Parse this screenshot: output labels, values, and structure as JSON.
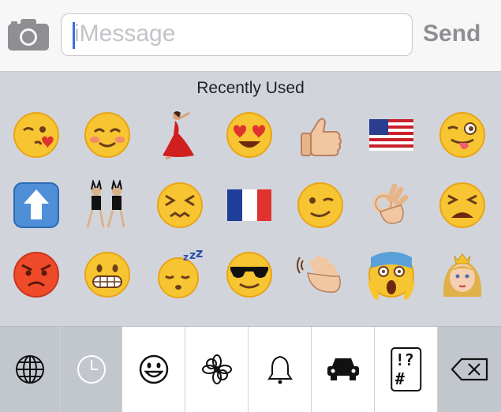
{
  "compose": {
    "placeholder": "iMessage",
    "send_label": "Send"
  },
  "emoji_panel": {
    "section_title": "Recently Used",
    "rows": [
      [
        "kissing-face-heart",
        "blushing-face",
        "dancer",
        "heart-eyes-face",
        "thumbs-up",
        "us-flag",
        "winking-tongue-face"
      ],
      [
        "up-arrow-button",
        "dancing-women",
        "confounded-face",
        "france-flag",
        "winking-face",
        "ok-hand",
        "tired-face"
      ],
      [
        "angry-face",
        "grimacing-face",
        "sleeping-face",
        "sunglasses-face",
        "waving-hand",
        "screaming-face",
        "princess"
      ]
    ]
  },
  "keyboard_tabs": [
    {
      "name": "globe",
      "selected": false
    },
    {
      "name": "recent-clock",
      "selected": true
    },
    {
      "name": "smiley",
      "selected": false
    },
    {
      "name": "flower",
      "selected": false
    },
    {
      "name": "bell",
      "selected": false
    },
    {
      "name": "car",
      "selected": false
    },
    {
      "name": "symbols",
      "label": "!?#",
      "selected": false
    },
    {
      "name": "delete",
      "selected": false
    }
  ],
  "colors": {
    "face": "#f7c531",
    "face_shade": "#e9a417",
    "panel_bg": "#d1d5db",
    "cursor": "#3b6fe0"
  }
}
